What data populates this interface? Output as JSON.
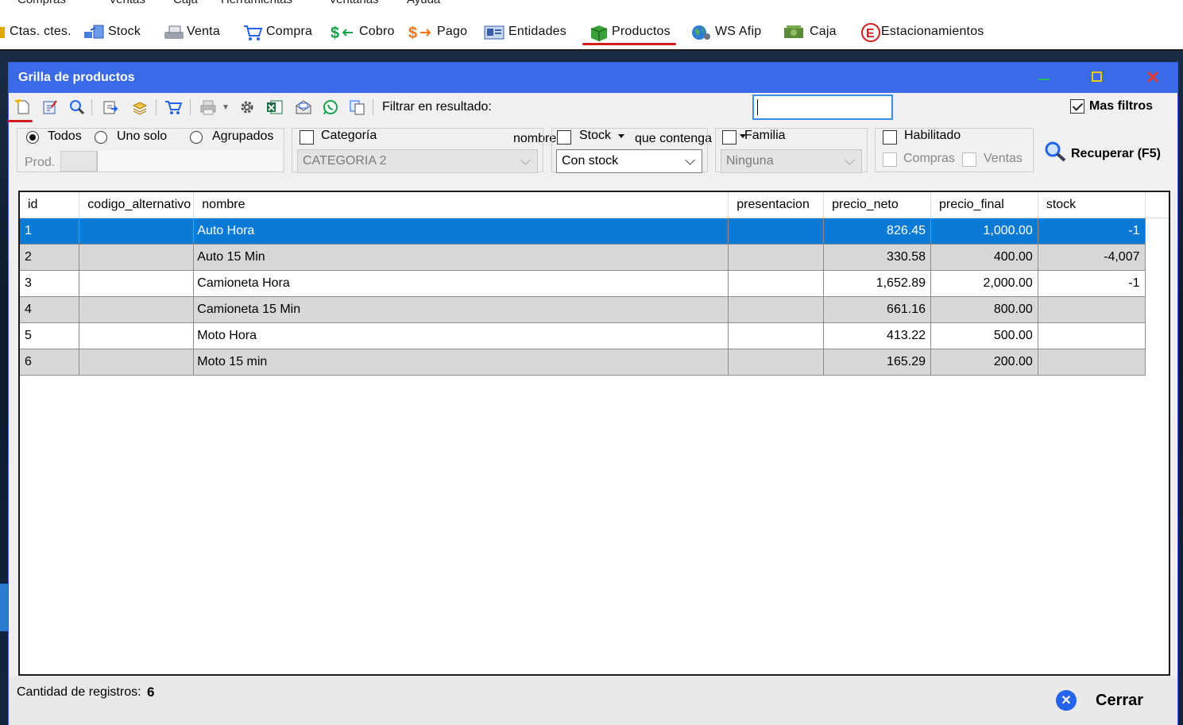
{
  "menubar": [
    "Compras",
    "Ventas",
    "Caja",
    "Herramientas",
    "Ventanas",
    "Ayuda"
  ],
  "app_toolbar": [
    {
      "label": "Ctas. ctes.",
      "icon": "accounts-icon"
    },
    {
      "label": "Stock",
      "icon": "stock-icon"
    },
    {
      "label": "Venta",
      "icon": "sale-icon"
    },
    {
      "label": "Compra",
      "icon": "cart-icon"
    },
    {
      "label": "Cobro",
      "icon": "cobro-icon"
    },
    {
      "label": "Pago",
      "icon": "pago-icon"
    },
    {
      "label": "Entidades",
      "icon": "entities-icon"
    },
    {
      "label": "Productos",
      "icon": "products-icon"
    },
    {
      "label": "WS Afip",
      "icon": "globe-icon"
    },
    {
      "label": "Caja",
      "icon": "cash-icon"
    },
    {
      "label": "Estacionamientos",
      "icon": "parking-icon"
    }
  ],
  "window": {
    "title": "Grilla de productos"
  },
  "grid_toolbar": {
    "filter_label": "Filtrar en resultado:",
    "field_value": "nombre",
    "operator_value": "que contenga",
    "search_value": "",
    "mas_filtros_label": "Mas filtros",
    "mas_filtros_checked": true
  },
  "filters": {
    "radios": {
      "todos": "Todos",
      "uno_solo": "Uno solo",
      "agrupados": "Agrupados",
      "selected": "Todos"
    },
    "prod_label": "Prod.",
    "categoria": {
      "label": "Categoría",
      "checked": false,
      "value": "CATEGORIA 2"
    },
    "stock": {
      "label": "Stock",
      "checked": false,
      "value": "Con stock"
    },
    "familia": {
      "label": "Familia",
      "checked": false,
      "value": "Ninguna"
    },
    "habilitado": {
      "label": "Habilitado",
      "checked": false,
      "compras": "Compras",
      "ventas": "Ventas"
    },
    "recuperar_label": "Recuperar (F5)"
  },
  "table": {
    "columns": [
      "id",
      "codigo_alternativo",
      "nombre",
      "presentacion",
      "precio_neto",
      "precio_final",
      "stock"
    ],
    "rows": [
      {
        "id": "1",
        "codigo_alternativo": "",
        "nombre": "Auto Hora",
        "presentacion": "",
        "precio_neto": "826.45",
        "precio_final": "1,000.00",
        "stock": "-1"
      },
      {
        "id": "2",
        "codigo_alternativo": "",
        "nombre": "Auto 15 Min",
        "presentacion": "",
        "precio_neto": "330.58",
        "precio_final": "400.00",
        "stock": "-4,007"
      },
      {
        "id": "3",
        "codigo_alternativo": "",
        "nombre": "Camioneta Hora",
        "presentacion": "",
        "precio_neto": "1,652.89",
        "precio_final": "2,000.00",
        "stock": "-1"
      },
      {
        "id": "4",
        "codigo_alternativo": "",
        "nombre": "Camioneta 15 Min",
        "presentacion": "",
        "precio_neto": "661.16",
        "precio_final": "800.00",
        "stock": ""
      },
      {
        "id": "5",
        "codigo_alternativo": "",
        "nombre": "Moto Hora",
        "presentacion": "",
        "precio_neto": "413.22",
        "precio_final": "500.00",
        "stock": ""
      },
      {
        "id": "6",
        "codigo_alternativo": "",
        "nombre": "Moto 15 min",
        "presentacion": "",
        "precio_neto": "165.29",
        "precio_final": "200.00",
        "stock": ""
      }
    ],
    "selected_row": 0
  },
  "footer": {
    "count_label": "Cantidad de registros:",
    "count_value": "6",
    "close_label": "Cerrar"
  },
  "colors": {
    "titlebar": "#3b6ae8",
    "selection": "#0a7ad6",
    "active_underline": "#d21b1b"
  }
}
